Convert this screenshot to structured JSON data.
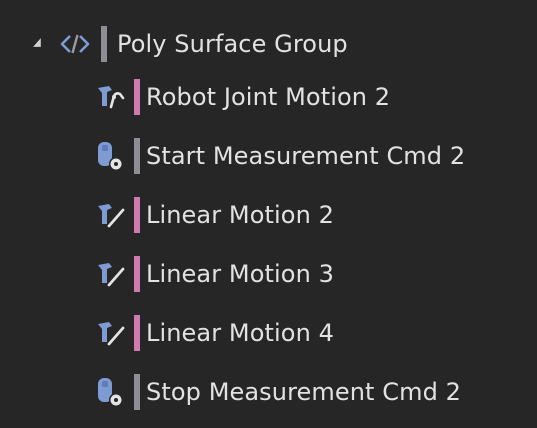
{
  "colors": {
    "background": "#262626",
    "text": "#e2e2e2",
    "motion_tag": "#d07ab0",
    "command_tag": "#8e8e93",
    "group_tag": "#8e8e93",
    "icon_blue": "#7f9bd4",
    "icon_gray": "#c8c8c8"
  },
  "tree": {
    "group": {
      "label": "Poly Surface Group",
      "icon": "code-brackets-icon",
      "expanded": true
    },
    "children": [
      {
        "label": "Robot Joint Motion 2",
        "icon": "joint-motion-icon",
        "kind": "motion"
      },
      {
        "label": "Start Measurement Cmd 2",
        "icon": "measurement-command-icon",
        "kind": "command"
      },
      {
        "label": "Linear Motion 2",
        "icon": "linear-motion-icon",
        "kind": "motion"
      },
      {
        "label": "Linear Motion 3",
        "icon": "linear-motion-icon",
        "kind": "motion"
      },
      {
        "label": "Linear Motion 4",
        "icon": "linear-motion-icon",
        "kind": "motion"
      },
      {
        "label": "Stop Measurement Cmd 2",
        "icon": "measurement-command-icon",
        "kind": "command"
      }
    ]
  }
}
